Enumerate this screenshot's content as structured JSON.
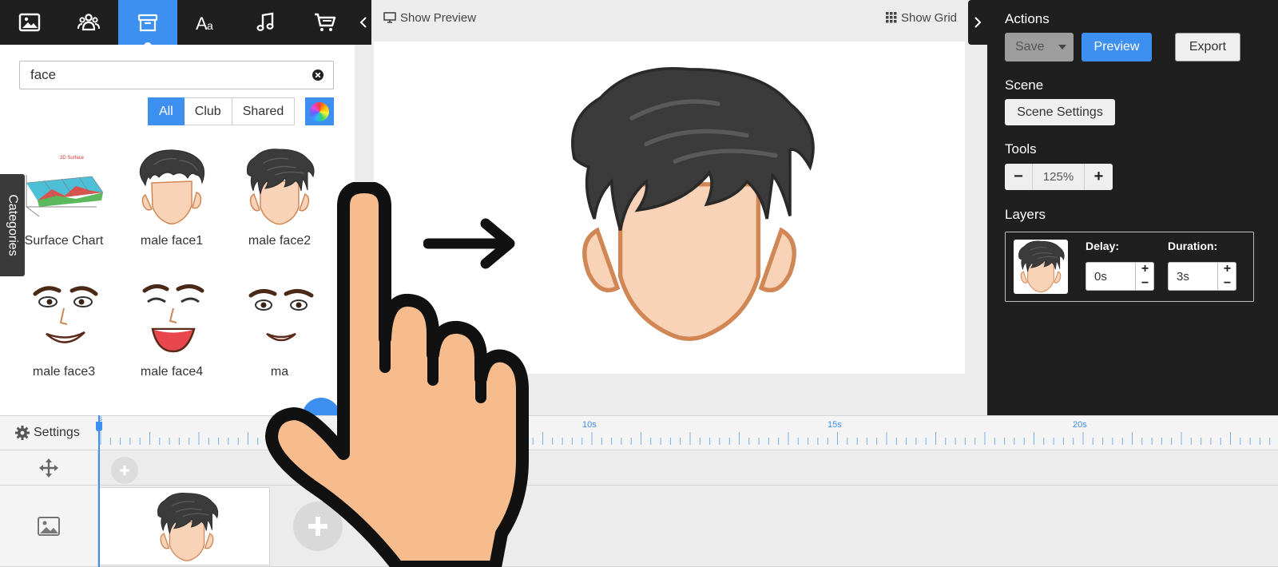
{
  "toolbar": {
    "items": [
      {
        "icon": "image-icon"
      },
      {
        "icon": "people-icon"
      },
      {
        "icon": "archive-box-icon",
        "active": true
      },
      {
        "icon": "text-font-icon"
      },
      {
        "icon": "music-note-icon"
      },
      {
        "icon": "shopping-cart-icon"
      }
    ],
    "collapse_icon": "chevron-left-icon"
  },
  "library": {
    "search": {
      "value": "face"
    },
    "filters": [
      "All",
      "Club",
      "Shared"
    ],
    "active_filter": "All",
    "categories_label": "Categories",
    "assets": [
      {
        "label": "Surface Chart"
      },
      {
        "label": "male face1"
      },
      {
        "label": "male face2"
      },
      {
        "label": "male face3"
      },
      {
        "label": "male face4"
      },
      {
        "label": "ma"
      }
    ]
  },
  "canvas": {
    "show_preview": "Show Preview",
    "show_grid": "Show Grid"
  },
  "right_panel": {
    "actions_heading": "Actions",
    "save_label": "Save",
    "preview_label": "Preview",
    "export_label": "Export",
    "scene_heading": "Scene",
    "scene_settings_label": "Scene Settings",
    "tools_heading": "Tools",
    "zoom_minus": "−",
    "zoom_value": "125%",
    "zoom_plus": "+",
    "layers_heading": "Layers",
    "layer": {
      "delay_label": "Delay:",
      "delay_value": "0s",
      "duration_label": "Duration:",
      "duration_value": "3s"
    }
  },
  "timeline": {
    "settings_label": "Settings",
    "ruler_labels": [
      "s",
      "10s",
      "15s",
      "20s"
    ]
  },
  "colors": {
    "accent": "#3d8ff0",
    "toolbar_bg": "#1f1f1f",
    "panel_bg": "#1f1f1f",
    "hair": "#3b3b3b",
    "skin": "#f9d3b8",
    "skin_outline": "#d08755",
    "hand": "#f6bc8d"
  }
}
